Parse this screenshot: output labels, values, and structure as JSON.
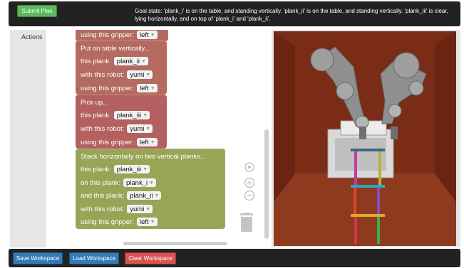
{
  "header": {
    "submit_label": "Submit Plan",
    "goal_text": "Goal state: 'plank_i' is on the table, and standing vertically. 'plank_ii' is on the table, and standing vertically. 'plank_iii' is clear, lying horizontally, and on top of 'plank_i' and 'plank_ii'."
  },
  "sidebar": {
    "actions_label": "Actions"
  },
  "blocks": [
    {
      "color": "#b46a60",
      "rows": [
        {
          "label": "using this gripper:",
          "value": "left"
        }
      ]
    },
    {
      "color": "#b46a60",
      "rows": [
        {
          "label": "Put on table vertically...",
          "value": null
        },
        {
          "label": "this plank:",
          "value": "plank_ii"
        },
        {
          "label": "with this robot:",
          "value": "yumi"
        },
        {
          "label": "using this gripper:",
          "value": "left"
        }
      ]
    },
    {
      "color": "#b46060",
      "rows": [
        {
          "label": "Pick up...",
          "value": null
        },
        {
          "label": "this plank:",
          "value": "plank_iii"
        },
        {
          "label": "with this robot:",
          "value": "yumi"
        },
        {
          "label": "using this gripper:",
          "value": "left"
        }
      ]
    },
    {
      "color": "#98a556",
      "rows": [
        {
          "label": "Stack horizontally on two vertical planks...",
          "value": null
        },
        {
          "label": "this plank:",
          "value": "plank_iii"
        },
        {
          "label": "on this plank:",
          "value": "plank_i"
        },
        {
          "label": "and this plank:",
          "value": "plank_ii"
        },
        {
          "label": "with this robot:",
          "value": "yumi"
        },
        {
          "label": "using this gripper:",
          "value": "left"
        }
      ]
    }
  ],
  "footer": {
    "save_label": "Save Workspace",
    "load_label": "Load Workspace",
    "clear_label": "Clear Workspace"
  },
  "colors": {
    "submit": "#5cb85c",
    "save": "#337ab7",
    "load": "#337ab7",
    "clear": "#d9534f",
    "scene_wall": "#7b2d16"
  },
  "icons": [
    "target-icon",
    "zoom-in-icon",
    "zoom-out-icon",
    "trash-icon",
    "dropdown-caret-icon"
  ]
}
